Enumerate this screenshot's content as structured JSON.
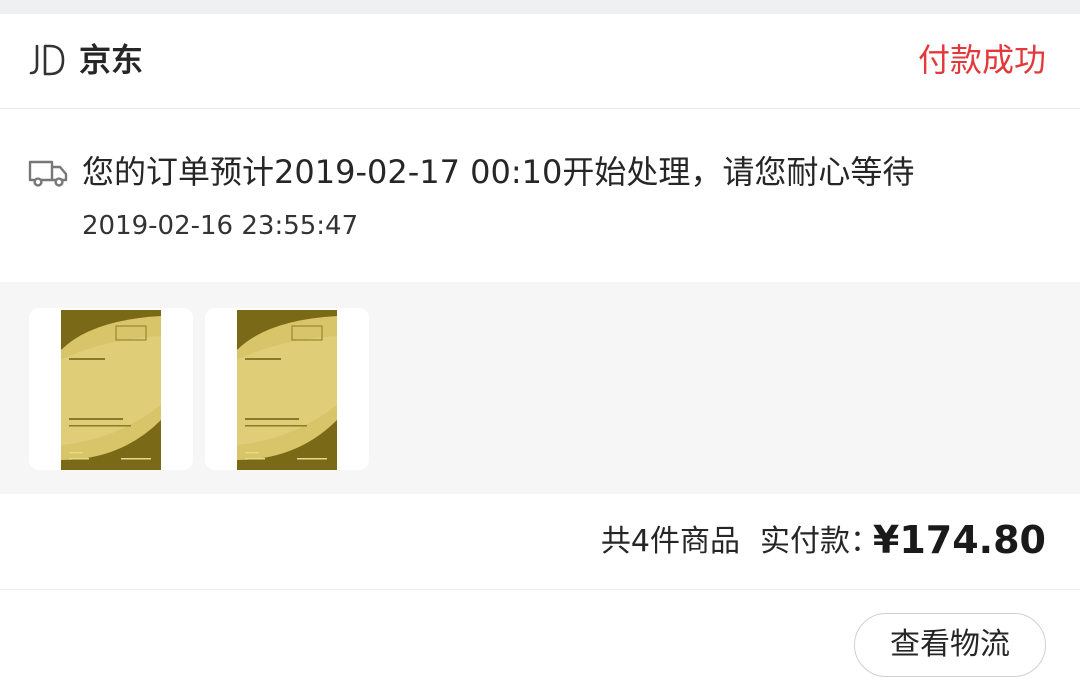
{
  "store": {
    "logo_text": "JD",
    "name": "京东",
    "status": "付款成功",
    "status_color": "#e4393c"
  },
  "tracking": {
    "icon": "truck-icon",
    "message": "您的订单预计2019-02-17 00:10开始处理，请您耐心等待",
    "time": "2019-02-16 23:55:47"
  },
  "goods": {
    "items": [
      {
        "image": "product-package-image"
      },
      {
        "image": "product-package-image"
      }
    ]
  },
  "summary": {
    "count_label": "共4件商品",
    "paid_label": "实付款：",
    "amount": "¥174.80"
  },
  "actions": {
    "logistics_label": "查看物流"
  }
}
